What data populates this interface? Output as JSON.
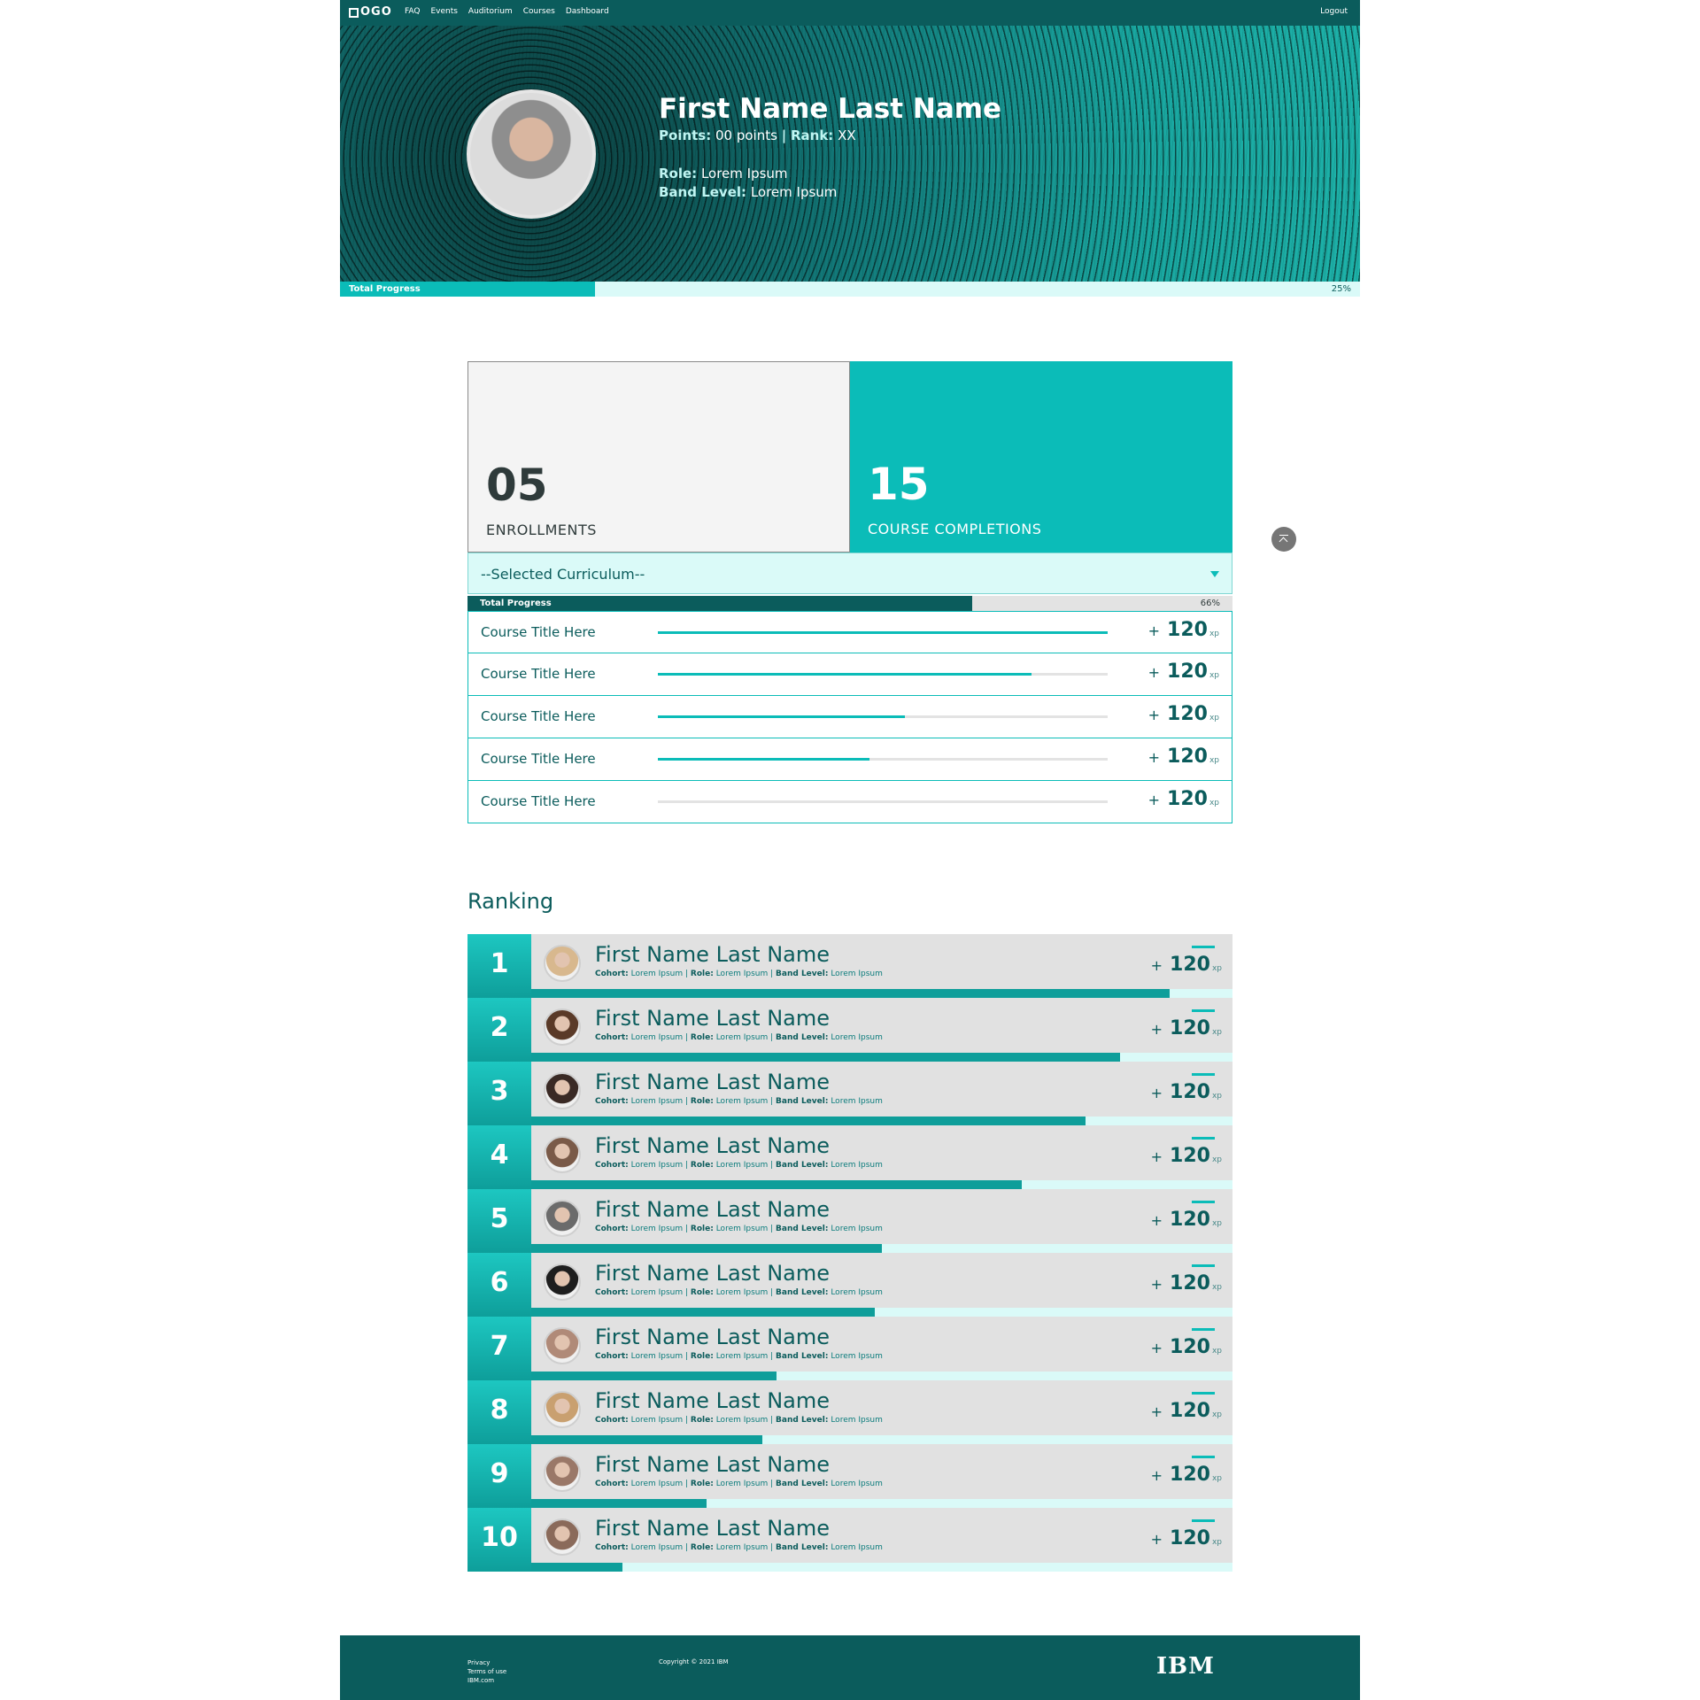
{
  "nav": {
    "logo": "OGO",
    "links": [
      "FAQ",
      "Events",
      "Auditorium",
      "Courses",
      "Dashboard"
    ],
    "logout": "Logout"
  },
  "profile": {
    "name": "First Name Last Name",
    "points_label": "Points:",
    "points_value": "00 points",
    "separator": "|",
    "rank_label": "Rank:",
    "rank_value": "XX",
    "role_label": "Role:",
    "role_value": "Lorem Ipsum",
    "band_label": "Band Level:",
    "band_value": "Lorem Ipsum"
  },
  "total_progress": {
    "label": "Total Progress",
    "percent_text": "25%",
    "value": 0.25
  },
  "stats": {
    "enrollments": {
      "value": "05",
      "label": "ENROLLMENTS"
    },
    "completions": {
      "value": "15",
      "label": "COURSE COMPLETIONS"
    }
  },
  "curriculum": {
    "selected": "--Selected Curriculum--",
    "progress_label": "Total Progress",
    "progress_text": "66%",
    "progress_value": 0.66
  },
  "courses": [
    {
      "title": "Course Title Here",
      "progress": 1.0,
      "plus": "+",
      "xp": "120",
      "unit": "xp"
    },
    {
      "title": "Course Title Here",
      "progress": 0.83,
      "plus": "+",
      "xp": "120",
      "unit": "xp"
    },
    {
      "title": "Course Title Here",
      "progress": 0.55,
      "plus": "+",
      "xp": "120",
      "unit": "xp"
    },
    {
      "title": "Course Title Here",
      "progress": 0.47,
      "plus": "+",
      "xp": "120",
      "unit": "xp"
    },
    {
      "title": "Course Title Here",
      "progress": 0.0,
      "plus": "+",
      "xp": "120",
      "unit": "xp"
    }
  ],
  "ranking": {
    "title": "Ranking",
    "cohort_label": "Cohort:",
    "role_label": "Role:",
    "band_label": "Band Level:",
    "entries": [
      {
        "rank": "1",
        "name": "First Name Last Name",
        "cohort": "Lorem Ipsum",
        "role": "Lorem Ipsum",
        "band": "Lorem Ipsum",
        "plus": "+",
        "xp": "120",
        "unit": "xp",
        "progress": 0.91,
        "avatar_color": "#d8b88e"
      },
      {
        "rank": "2",
        "name": "First Name Last Name",
        "cohort": "Lorem Ipsum",
        "role": "Lorem Ipsum",
        "band": "Lorem Ipsum",
        "plus": "+",
        "xp": "120",
        "unit": "xp",
        "progress": 0.84,
        "avatar_color": "#5a3a28"
      },
      {
        "rank": "3",
        "name": "First Name Last Name",
        "cohort": "Lorem Ipsum",
        "role": "Lorem Ipsum",
        "band": "Lorem Ipsum",
        "plus": "+",
        "xp": "120",
        "unit": "xp",
        "progress": 0.79,
        "avatar_color": "#3a2a25"
      },
      {
        "rank": "4",
        "name": "First Name Last Name",
        "cohort": "Lorem Ipsum",
        "role": "Lorem Ipsum",
        "band": "Lorem Ipsum",
        "plus": "+",
        "xp": "120",
        "unit": "xp",
        "progress": 0.7,
        "avatar_color": "#7a5a48"
      },
      {
        "rank": "5",
        "name": "First Name Last Name",
        "cohort": "Lorem Ipsum",
        "role": "Lorem Ipsum",
        "band": "Lorem Ipsum",
        "plus": "+",
        "xp": "120",
        "unit": "xp",
        "progress": 0.5,
        "avatar_color": "#6b6b6b"
      },
      {
        "rank": "6",
        "name": "First Name Last Name",
        "cohort": "Lorem Ipsum",
        "role": "Lorem Ipsum",
        "band": "Lorem Ipsum",
        "plus": "+",
        "xp": "120",
        "unit": "xp",
        "progress": 0.49,
        "avatar_color": "#1e1e1e"
      },
      {
        "rank": "7",
        "name": "First Name Last Name",
        "cohort": "Lorem Ipsum",
        "role": "Lorem Ipsum",
        "band": "Lorem Ipsum",
        "plus": "+",
        "xp": "120",
        "unit": "xp",
        "progress": 0.35,
        "avatar_color": "#b08a78"
      },
      {
        "rank": "8",
        "name": "First Name Last Name",
        "cohort": "Lorem Ipsum",
        "role": "Lorem Ipsum",
        "band": "Lorem Ipsum",
        "plus": "+",
        "xp": "120",
        "unit": "xp",
        "progress": 0.33,
        "avatar_color": "#c9a070"
      },
      {
        "rank": "9",
        "name": "First Name Last Name",
        "cohort": "Lorem Ipsum",
        "role": "Lorem Ipsum",
        "band": "Lorem Ipsum",
        "plus": "+",
        "xp": "120",
        "unit": "xp",
        "progress": 0.25,
        "avatar_color": "#9a7868"
      },
      {
        "rank": "10",
        "name": "First Name Last Name",
        "cohort": "Lorem Ipsum",
        "role": "Lorem Ipsum",
        "band": "Lorem Ipsum",
        "plus": "+",
        "xp": "120",
        "unit": "xp",
        "progress": 0.13,
        "avatar_color": "#8a6a5a"
      }
    ]
  },
  "footer": {
    "links": [
      "Privacy",
      "Terms of use",
      "IBM.com"
    ],
    "copyright": "Copyright © 2021 IBM",
    "brand": "IBM"
  },
  "colors": {
    "dark_teal": "#0b5c5c",
    "accent_teal": "#0bbcb8",
    "light_teal": "#dafaf8"
  }
}
